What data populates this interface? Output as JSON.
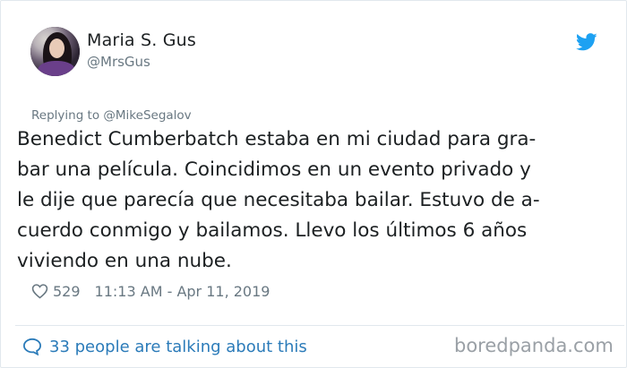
{
  "author": {
    "name": "Maria S. Gus",
    "handle": "@MrsGus"
  },
  "reply": {
    "text": "Replying to @MikeSegalov"
  },
  "tweet": {
    "lines": [
      "Benedict Cumberbatch estaba en mi ciudad para gra-",
      "bar una película. Coincidimos en un evento privado y",
      "le dije que parecía que necesitaba bailar. Estuvo de a-",
      "cuerdo conmigo y bailamos. Llevo los últimos 6 años",
      "viviendo en una nube."
    ]
  },
  "meta": {
    "likes": "529",
    "timestamp": "11:13 AM - Apr 11, 2019"
  },
  "footer": {
    "talking": "33 people are talking about this"
  },
  "watermark": {
    "text": "boredpanda.com"
  },
  "icons": {
    "twitter": "twitter-bird-icon",
    "heart": "heart-icon",
    "conversation": "speech-bubble-icon"
  },
  "colors": {
    "twitter_blue": "#1da1f2",
    "link_blue": "#2b7bb9",
    "secondary_text": "#697882",
    "primary_text": "#1c2022",
    "border": "#e1e8ed"
  }
}
